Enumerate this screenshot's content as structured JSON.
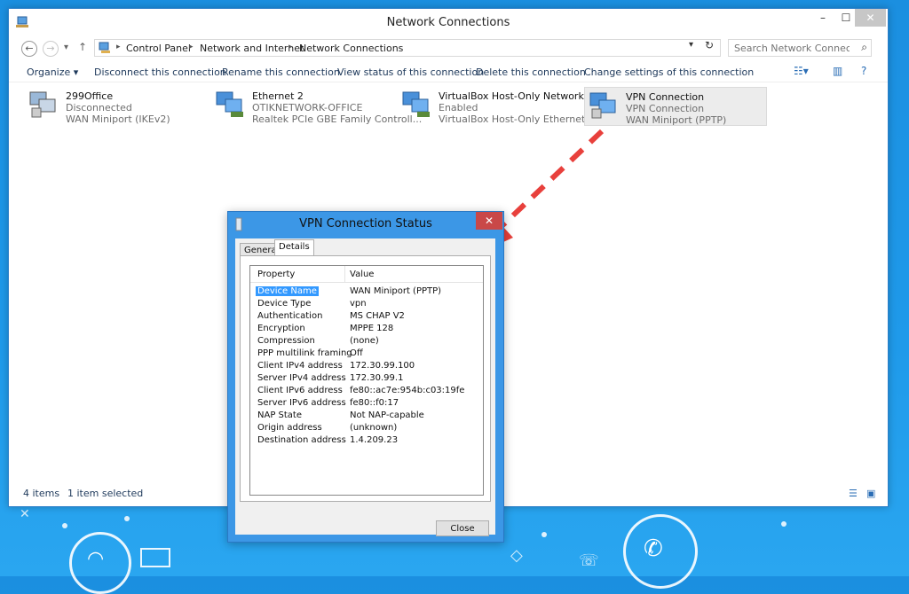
{
  "window": {
    "title": "Network Connections",
    "min": "–",
    "max": "☐",
    "close": "✕"
  },
  "address": {
    "crumbs": [
      "Control Panel",
      "Network and Internet",
      "Network Connections"
    ],
    "search_placeholder": "Search Network Connections"
  },
  "commandbar": {
    "items": [
      "Organize ▾",
      "Disconnect this connection",
      "Rename this connection",
      "View status of this connection",
      "Delete this connection",
      "Change settings of this connection"
    ]
  },
  "connections": [
    {
      "name": "299Office",
      "status": "Disconnected",
      "device": "WAN Miniport (IKEv2)"
    },
    {
      "name": "Ethernet 2",
      "status": "OTIKNETWORK-OFFICE",
      "device": "Realtek PCIe GBE Family Controll..."
    },
    {
      "name": "VirtualBox Host-Only Network",
      "status": "Enabled",
      "device": "VirtualBox Host-Only Ethernet Ad..."
    },
    {
      "name": "VPN Connection",
      "status": "VPN Connection",
      "device": "WAN Miniport (PPTP)"
    }
  ],
  "statusbar": {
    "count": "4 items",
    "selected": "1 item selected"
  },
  "dialog": {
    "title": "VPN Connection Status",
    "close": "✕",
    "tabs": [
      "General",
      "Details"
    ],
    "header": {
      "property": "Property",
      "value": "Value"
    },
    "rows": [
      {
        "property": "Device Name",
        "value": "WAN Miniport (PPTP)"
      },
      {
        "property": "Device Type",
        "value": "vpn"
      },
      {
        "property": "Authentication",
        "value": "MS CHAP V2"
      },
      {
        "property": "Encryption",
        "value": "MPPE 128"
      },
      {
        "property": "Compression",
        "value": "(none)"
      },
      {
        "property": "PPP multilink framing",
        "value": "Off"
      },
      {
        "property": "Client IPv4 address",
        "value": "172.30.99.100"
      },
      {
        "property": "Server IPv4 address",
        "value": "172.30.99.1"
      },
      {
        "property": "Client IPv6 address",
        "value": "fe80::ac7e:954b:c03:19fe"
      },
      {
        "property": "Server IPv6 address",
        "value": "fe80::f0:17"
      },
      {
        "property": "NAP State",
        "value": "Not NAP-capable"
      },
      {
        "property": "Origin address",
        "value": "(unknown)"
      },
      {
        "property": "Destination address",
        "value": "1.4.209.23"
      }
    ],
    "close_button": "Close"
  },
  "colors": {
    "desktop": "#1f9aea",
    "arrow": "#e8403c",
    "selection": "#3399ff"
  }
}
